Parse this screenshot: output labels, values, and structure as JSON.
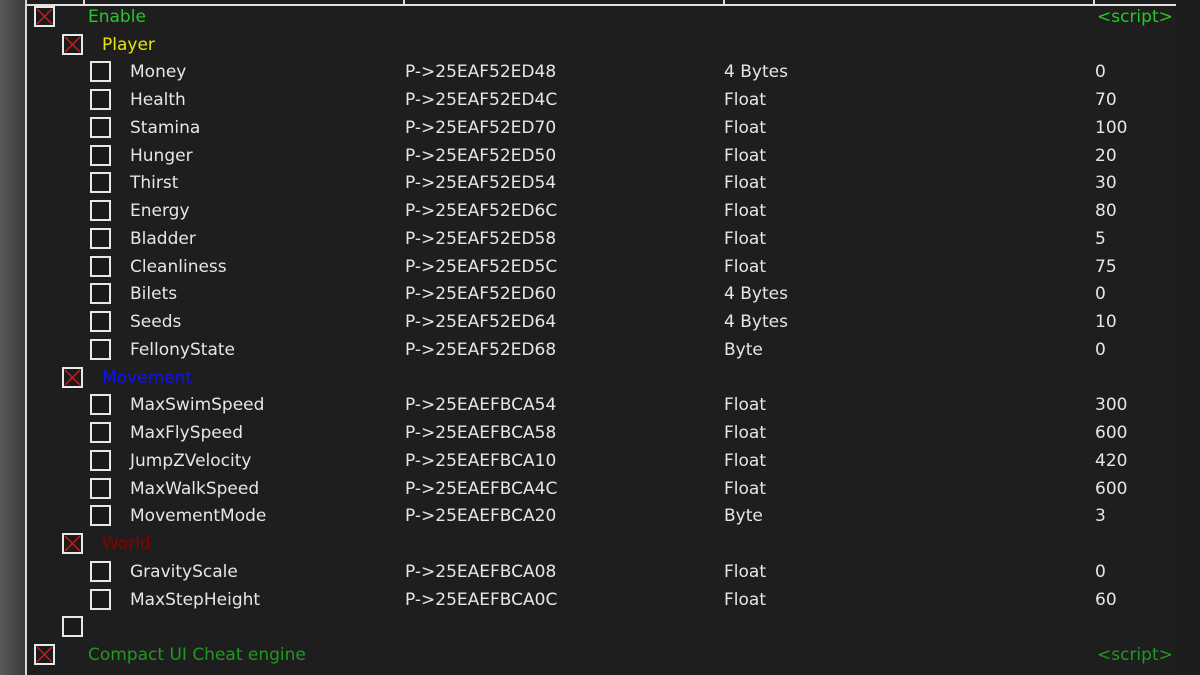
{
  "colors": {
    "enable": "#22cc22",
    "player": "#e8e800",
    "movement": "#1010ff",
    "world": "#8a0000",
    "compact": "#1f9a1f",
    "item": "#e6e6e6",
    "check": "#d01818"
  },
  "rows": [
    {
      "level": 0,
      "checked": true,
      "label": "Enable",
      "color": "enable",
      "value": "<script>"
    },
    {
      "level": 1,
      "checked": true,
      "label": "Player",
      "color": "player"
    },
    {
      "level": 2,
      "checked": false,
      "label": "Money",
      "address": "P->25EAF52ED48",
      "type": "4 Bytes",
      "value": "0"
    },
    {
      "level": 2,
      "checked": false,
      "label": "Health",
      "address": "P->25EAF52ED4C",
      "type": "Float",
      "value": "70"
    },
    {
      "level": 2,
      "checked": false,
      "label": "Stamina",
      "address": "P->25EAF52ED70",
      "type": "Float",
      "value": "100"
    },
    {
      "level": 2,
      "checked": false,
      "label": "Hunger",
      "address": "P->25EAF52ED50",
      "type": "Float",
      "value": "20"
    },
    {
      "level": 2,
      "checked": false,
      "label": "Thirst",
      "address": "P->25EAF52ED54",
      "type": "Float",
      "value": "30"
    },
    {
      "level": 2,
      "checked": false,
      "label": "Energy",
      "address": "P->25EAF52ED6C",
      "type": "Float",
      "value": "80"
    },
    {
      "level": 2,
      "checked": false,
      "label": "Bladder",
      "address": "P->25EAF52ED58",
      "type": "Float",
      "value": "5"
    },
    {
      "level": 2,
      "checked": false,
      "label": "Cleanliness",
      "address": "P->25EAF52ED5C",
      "type": "Float",
      "value": "75"
    },
    {
      "level": 2,
      "checked": false,
      "label": "Bilets",
      "address": "P->25EAF52ED60",
      "type": "4 Bytes",
      "value": "0"
    },
    {
      "level": 2,
      "checked": false,
      "label": "Seeds",
      "address": "P->25EAF52ED64",
      "type": "4 Bytes",
      "value": "10"
    },
    {
      "level": 2,
      "checked": false,
      "label": "FellonyState",
      "address": "P->25EAF52ED68",
      "type": "Byte",
      "value": "0"
    },
    {
      "level": 1,
      "checked": true,
      "label": "Movement",
      "color": "movement"
    },
    {
      "level": 2,
      "checked": false,
      "label": "MaxSwimSpeed",
      "address": "P->25EAEFBCA54",
      "type": "Float",
      "value": "300"
    },
    {
      "level": 2,
      "checked": false,
      "label": "MaxFlySpeed",
      "address": "P->25EAEFBCA58",
      "type": "Float",
      "value": "600"
    },
    {
      "level": 2,
      "checked": false,
      "label": "JumpZVelocity",
      "address": "P->25EAEFBCA10",
      "type": "Float",
      "value": "420"
    },
    {
      "level": 2,
      "checked": false,
      "label": "MaxWalkSpeed",
      "address": "P->25EAEFBCA4C",
      "type": "Float",
      "value": "600"
    },
    {
      "level": 2,
      "checked": false,
      "label": "MovementMode",
      "address": "P->25EAEFBCA20",
      "type": "Byte",
      "value": "3"
    },
    {
      "level": 1,
      "checked": true,
      "label": "World",
      "color": "world"
    },
    {
      "level": 2,
      "checked": false,
      "label": "GravityScale",
      "address": "P->25EAEFBCA08",
      "type": "Float",
      "value": "0"
    },
    {
      "level": 2,
      "checked": false,
      "label": "MaxStepHeight",
      "address": "P->25EAEFBCA0C",
      "type": "Float",
      "value": "60"
    },
    {
      "level": 1,
      "checked": false,
      "label": ""
    },
    {
      "level": 0,
      "checked": true,
      "label": "Compact UI Cheat engine",
      "color": "compact",
      "value": "<script>"
    }
  ]
}
